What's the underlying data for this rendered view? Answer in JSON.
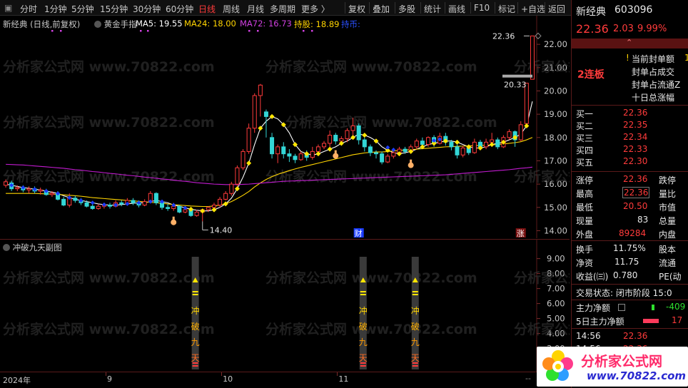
{
  "toolbar": {
    "left_items": [
      "分时",
      "1分钟",
      "5分钟",
      "15分钟",
      "30分钟",
      "60分钟",
      "日线",
      "周线",
      "月线",
      "多周期",
      "更多 〉"
    ],
    "active": "日线",
    "right_items": [
      "复权",
      "叠加",
      "多股",
      "统计",
      "画线",
      "F10",
      "标记",
      "+自选",
      "返回"
    ]
  },
  "chart_header": {
    "stock_label": "新经典 (日线,前复权)",
    "indicator": "黄金手指",
    "ma5": "MA5: 19.55",
    "ma24": "MA24: 18.00",
    "ma72": "MA72: 16.73",
    "hold": "持股: 18.89",
    "hold_suffix": "持币:"
  },
  "colors": {
    "red": "#ff3b3b",
    "green": "#2ee02e",
    "cyan": "#33d6d6",
    "ma5": "#ffffff",
    "ma24": "#ffd400",
    "ma72": "#c21bd0",
    "dots": "#ffe600",
    "blue_dots": "#1a3cff"
  },
  "chart_data": {
    "type": "candlestick",
    "title": "新经典 (日线,前复权)",
    "y_ticks": [
      "22.00",
      "21.00",
      "20.00",
      "19.00",
      "18.00",
      "17.00",
      "16.00",
      "15.00",
      "14.00"
    ],
    "ylim": [
      13.8,
      22.8
    ],
    "annotations": {
      "high_label": "22.36",
      "low_label": "14.40",
      "current_price_tag": "20.33",
      "cai_marker": "财",
      "zhang_marker": "涨"
    },
    "candles": [
      {
        "o": 15.95,
        "c": 16.1,
        "h": 16.2,
        "l": 15.85
      },
      {
        "o": 16.05,
        "c": 15.8,
        "h": 16.15,
        "l": 15.7
      },
      {
        "o": 15.8,
        "c": 15.85,
        "h": 15.95,
        "l": 15.7
      },
      {
        "o": 15.85,
        "c": 15.75,
        "h": 15.95,
        "l": 15.65
      },
      {
        "o": 15.75,
        "c": 15.8,
        "h": 15.9,
        "l": 15.6
      },
      {
        "o": 15.8,
        "c": 15.7,
        "h": 15.9,
        "l": 15.6
      },
      {
        "o": 15.7,
        "c": 15.75,
        "h": 15.85,
        "l": 15.55
      },
      {
        "o": 15.7,
        "c": 15.55,
        "h": 15.8,
        "l": 15.5
      },
      {
        "o": 15.55,
        "c": 15.6,
        "h": 15.7,
        "l": 15.45
      },
      {
        "o": 15.6,
        "c": 15.35,
        "h": 15.7,
        "l": 15.3
      },
      {
        "o": 15.35,
        "c": 15.1,
        "h": 15.45,
        "l": 15.05
      },
      {
        "o": 15.1,
        "c": 15.4,
        "h": 15.6,
        "l": 15.0
      },
      {
        "o": 15.4,
        "c": 15.3,
        "h": 15.5,
        "l": 15.2
      },
      {
        "o": 15.3,
        "c": 15.2,
        "h": 15.4,
        "l": 15.1
      },
      {
        "o": 15.2,
        "c": 15.05,
        "h": 15.3,
        "l": 15.0
      },
      {
        "o": 15.05,
        "c": 14.95,
        "h": 15.2,
        "l": 14.9
      },
      {
        "o": 14.95,
        "c": 15.05,
        "h": 15.15,
        "l": 14.9
      },
      {
        "o": 15.05,
        "c": 15.1,
        "h": 15.2,
        "l": 14.95
      },
      {
        "o": 15.1,
        "c": 15.05,
        "h": 15.2,
        "l": 14.95
      },
      {
        "o": 15.05,
        "c": 15.2,
        "h": 15.3,
        "l": 15.0
      },
      {
        "o": 15.2,
        "c": 15.15,
        "h": 15.3,
        "l": 15.05
      },
      {
        "o": 15.15,
        "c": 15.3,
        "h": 15.4,
        "l": 15.1
      },
      {
        "o": 15.3,
        "c": 15.2,
        "h": 15.4,
        "l": 15.1
      },
      {
        "o": 15.2,
        "c": 15.1,
        "h": 15.3,
        "l": 15.0
      },
      {
        "o": 15.1,
        "c": 15.25,
        "h": 15.35,
        "l": 15.05
      },
      {
        "o": 15.25,
        "c": 15.6,
        "h": 15.7,
        "l": 15.2
      },
      {
        "o": 15.6,
        "c": 15.2,
        "h": 15.65,
        "l": 15.1
      },
      {
        "o": 15.2,
        "c": 15.0,
        "h": 15.3,
        "l": 14.9
      },
      {
        "o": 15.0,
        "c": 14.95,
        "h": 15.15,
        "l": 14.85
      },
      {
        "o": 14.95,
        "c": 15.05,
        "h": 15.2,
        "l": 14.85
      },
      {
        "o": 15.05,
        "c": 14.8,
        "h": 15.1,
        "l": 14.75
      },
      {
        "o": 14.8,
        "c": 14.9,
        "h": 15.0,
        "l": 14.75
      },
      {
        "o": 14.9,
        "c": 14.65,
        "h": 14.95,
        "l": 14.6
      },
      {
        "o": 14.65,
        "c": 14.8,
        "h": 14.9,
        "l": 14.6
      },
      {
        "o": 14.8,
        "c": 14.9,
        "h": 14.95,
        "l": 14.4
      },
      {
        "o": 14.9,
        "c": 15.0,
        "h": 15.05,
        "l": 14.8
      },
      {
        "o": 15.0,
        "c": 15.1,
        "h": 15.2,
        "l": 14.9
      },
      {
        "o": 15.1,
        "c": 15.35,
        "h": 15.45,
        "l": 15.0
      },
      {
        "o": 15.35,
        "c": 15.6,
        "h": 15.7,
        "l": 15.3
      },
      {
        "o": 15.6,
        "c": 16.0,
        "h": 16.1,
        "l": 15.5
      },
      {
        "o": 16.0,
        "c": 16.7,
        "h": 16.8,
        "l": 15.9
      },
      {
        "o": 16.7,
        "c": 17.4,
        "h": 17.5,
        "l": 16.6
      },
      {
        "o": 17.4,
        "c": 18.4,
        "h": 18.6,
        "l": 17.3
      },
      {
        "o": 18.4,
        "c": 19.8,
        "h": 19.9,
        "l": 18.2
      },
      {
        "o": 19.8,
        "c": 20.25,
        "h": 20.3,
        "l": 18.9
      },
      {
        "o": 19.1,
        "c": 18.9,
        "h": 19.2,
        "l": 18.0
      },
      {
        "o": 18.0,
        "c": 17.3,
        "h": 18.2,
        "l": 17.1
      },
      {
        "o": 17.3,
        "c": 17.6,
        "h": 17.7,
        "l": 16.9
      },
      {
        "o": 17.6,
        "c": 17.3,
        "h": 17.8,
        "l": 17.1
      },
      {
        "o": 17.3,
        "c": 17.2,
        "h": 17.5,
        "l": 16.95
      },
      {
        "o": 17.2,
        "c": 17.05,
        "h": 17.3,
        "l": 16.9
      },
      {
        "o": 17.05,
        "c": 17.3,
        "h": 17.4,
        "l": 17.0
      },
      {
        "o": 17.3,
        "c": 17.15,
        "h": 17.45,
        "l": 17.0
      },
      {
        "o": 17.15,
        "c": 17.4,
        "h": 17.6,
        "l": 17.05
      },
      {
        "o": 17.4,
        "c": 17.6,
        "h": 17.7,
        "l": 17.3
      },
      {
        "o": 17.6,
        "c": 17.75,
        "h": 17.85,
        "l": 17.5
      },
      {
        "o": 17.75,
        "c": 18.1,
        "h": 18.3,
        "l": 17.6
      },
      {
        "o": 18.1,
        "c": 17.85,
        "h": 18.2,
        "l": 17.7
      },
      {
        "o": 17.85,
        "c": 17.95,
        "h": 18.05,
        "l": 17.7
      },
      {
        "o": 17.95,
        "c": 18.3,
        "h": 18.4,
        "l": 17.8
      },
      {
        "o": 18.3,
        "c": 18.5,
        "h": 18.85,
        "l": 18.0
      },
      {
        "o": 18.5,
        "c": 17.9,
        "h": 18.6,
        "l": 17.7
      },
      {
        "o": 17.9,
        "c": 17.6,
        "h": 18.0,
        "l": 17.4
      },
      {
        "o": 17.6,
        "c": 17.35,
        "h": 17.7,
        "l": 17.2
      },
      {
        "o": 17.35,
        "c": 17.3,
        "h": 17.45,
        "l": 17.1
      },
      {
        "o": 17.3,
        "c": 16.95,
        "h": 17.4,
        "l": 16.85
      },
      {
        "o": 16.95,
        "c": 17.2,
        "h": 17.3,
        "l": 16.9
      },
      {
        "o": 17.2,
        "c": 17.35,
        "h": 17.45,
        "l": 17.1
      },
      {
        "o": 17.35,
        "c": 17.5,
        "h": 17.6,
        "l": 17.25
      },
      {
        "o": 17.5,
        "c": 17.4,
        "h": 17.6,
        "l": 17.3
      },
      {
        "o": 17.4,
        "c": 17.6,
        "h": 17.7,
        "l": 17.3
      },
      {
        "o": 17.6,
        "c": 17.85,
        "h": 17.95,
        "l": 17.5
      },
      {
        "o": 17.85,
        "c": 17.7,
        "h": 18.0,
        "l": 17.6
      },
      {
        "o": 17.7,
        "c": 18.0,
        "h": 18.05,
        "l": 17.6
      },
      {
        "o": 18.0,
        "c": 17.75,
        "h": 18.1,
        "l": 17.6
      },
      {
        "o": 17.75,
        "c": 18.05,
        "h": 18.2,
        "l": 17.7
      },
      {
        "o": 18.05,
        "c": 17.8,
        "h": 18.2,
        "l": 17.65
      },
      {
        "o": 17.8,
        "c": 17.6,
        "h": 17.9,
        "l": 17.45
      },
      {
        "o": 17.6,
        "c": 17.25,
        "h": 17.7,
        "l": 17.1
      },
      {
        "o": 17.25,
        "c": 17.55,
        "h": 17.65,
        "l": 17.15
      },
      {
        "o": 17.55,
        "c": 17.35,
        "h": 17.7,
        "l": 17.25
      },
      {
        "o": 17.35,
        "c": 17.8,
        "h": 17.95,
        "l": 17.3
      },
      {
        "o": 17.8,
        "c": 17.6,
        "h": 17.9,
        "l": 17.5
      },
      {
        "o": 17.6,
        "c": 17.8,
        "h": 17.95,
        "l": 17.5
      },
      {
        "o": 17.8,
        "c": 17.9,
        "h": 18.2,
        "l": 17.7
      },
      {
        "o": 17.9,
        "c": 17.6,
        "h": 18.0,
        "l": 17.5
      },
      {
        "o": 17.6,
        "c": 18.0,
        "h": 18.1,
        "l": 17.55
      },
      {
        "o": 18.0,
        "c": 18.25,
        "h": 18.35,
        "l": 17.9
      },
      {
        "o": 18.25,
        "c": 17.9,
        "h": 18.3,
        "l": 17.6
      },
      {
        "o": 17.9,
        "c": 18.55,
        "h": 18.7,
        "l": 17.85
      },
      {
        "o": 18.6,
        "c": 20.33,
        "h": 20.33,
        "l": 18.5
      },
      {
        "o": 20.5,
        "c": 22.36,
        "h": 22.36,
        "l": 20.5
      }
    ],
    "series": [
      {
        "name": "MA5",
        "values": [
          16.0,
          15.95,
          15.9,
          15.85,
          15.82,
          15.78,
          15.75,
          15.7,
          15.65,
          15.6,
          15.5,
          15.42,
          15.35,
          15.3,
          15.25,
          15.2,
          15.15,
          15.12,
          15.1,
          15.1,
          15.12,
          15.15,
          15.18,
          15.2,
          15.2,
          15.25,
          15.3,
          15.25,
          15.2,
          15.1,
          15.05,
          14.98,
          14.92,
          14.88,
          14.85,
          14.85,
          14.9,
          15.0,
          15.15,
          15.4,
          15.8,
          16.3,
          16.9,
          17.7,
          18.4,
          18.7,
          18.9,
          18.8,
          18.55,
          18.2,
          17.7,
          17.4,
          17.3,
          17.25,
          17.3,
          17.4,
          17.5,
          17.6,
          17.75,
          17.85,
          18.0,
          18.15,
          18.1,
          18.0,
          17.85,
          17.6,
          17.45,
          17.35,
          17.3,
          17.35,
          17.4,
          17.5,
          17.6,
          17.7,
          17.75,
          17.8,
          17.85,
          17.85,
          17.8,
          17.7,
          17.6,
          17.55,
          17.55,
          17.6,
          17.7,
          17.75,
          17.8,
          17.9,
          18.0,
          18.15,
          18.5,
          19.55
        ]
      },
      {
        "name": "MA24",
        "values": [
          15.6,
          15.6,
          15.6,
          15.6,
          15.6,
          15.6,
          15.59,
          15.58,
          15.57,
          15.56,
          15.54,
          15.52,
          15.5,
          15.48,
          15.45,
          15.42,
          15.4,
          15.38,
          15.36,
          15.34,
          15.32,
          15.3,
          15.28,
          15.26,
          15.24,
          15.22,
          15.2,
          15.18,
          15.15,
          15.12,
          15.1,
          15.08,
          15.06,
          15.05,
          15.04,
          15.04,
          15.06,
          15.1,
          15.16,
          15.25,
          15.38,
          15.52,
          15.68,
          15.88,
          16.05,
          16.2,
          16.32,
          16.42,
          16.5,
          16.58,
          16.65,
          16.72,
          16.78,
          16.84,
          16.9,
          16.96,
          17.02,
          17.08,
          17.14,
          17.2,
          17.26,
          17.3,
          17.34,
          17.36,
          17.38,
          17.38,
          17.4,
          17.42,
          17.44,
          17.46,
          17.48,
          17.5,
          17.52,
          17.54,
          17.56,
          17.58,
          17.6,
          17.61,
          17.62,
          17.63,
          17.64,
          17.65,
          17.66,
          17.67,
          17.68,
          17.7,
          17.72,
          17.75,
          17.78,
          17.82,
          17.9,
          18.0
        ]
      },
      {
        "name": "MA72",
        "values": [
          16.85,
          16.84,
          16.83,
          16.82,
          16.8,
          16.78,
          16.76,
          16.74,
          16.72,
          16.7,
          16.68,
          16.65,
          16.62,
          16.6,
          16.57,
          16.54,
          16.52,
          16.49,
          16.46,
          16.44,
          16.41,
          16.38,
          16.36,
          16.33,
          16.3,
          16.28,
          16.25,
          16.22,
          16.2,
          16.17,
          16.14,
          16.12,
          16.09,
          16.06,
          16.04,
          16.02,
          16.0,
          15.99,
          15.98,
          15.98,
          15.98,
          15.99,
          16.0,
          16.02,
          16.04,
          16.06,
          16.08,
          16.1,
          16.12,
          16.13,
          16.14,
          16.15,
          16.16,
          16.17,
          16.18,
          16.19,
          16.2,
          16.21,
          16.22,
          16.23,
          16.24,
          16.25,
          16.26,
          16.27,
          16.28,
          16.29,
          16.3,
          16.31,
          16.32,
          16.33,
          16.34,
          16.35,
          16.36,
          16.37,
          16.38,
          16.39,
          16.4,
          16.42,
          16.44,
          16.46,
          16.48,
          16.5,
          16.52,
          16.54,
          16.56,
          16.58,
          16.6,
          16.62,
          16.65,
          16.68,
          16.7,
          16.73
        ]
      }
    ],
    "golden_finger_start": 32,
    "sub_chart": {
      "title": "冲破九天副图",
      "y_ticks": [
        "9.00",
        "8.00",
        "7.00",
        "6.00",
        "5.00",
        "4.00",
        "3.00",
        "2.00"
      ],
      "ylim": [
        1.6,
        9.6
      ],
      "signal_positions": [
        33,
        62,
        71
      ],
      "signal_text": [
        "冲",
        "破",
        "九",
        "天"
      ]
    },
    "x_labels": [
      {
        "label": "2024年",
        "i": 0
      },
      {
        "label": "9",
        "i": 18
      },
      {
        "label": "10",
        "i": 38
      },
      {
        "label": "11",
        "i": 58
      }
    ]
  },
  "right_panel": {
    "stock_name": "新经典",
    "stock_code": "603096",
    "price": "22.36",
    "change": "2.03",
    "change_pct": "9.99%",
    "board_tag": "2连板",
    "seal_items": [
      "当前封单额",
      "封单占成交",
      "封单占流通Z",
      "十日总涨幅"
    ],
    "seal_value": "1",
    "buy_levels": [
      {
        "label": "买一",
        "price": "22.36"
      },
      {
        "label": "买二",
        "price": "22.35"
      },
      {
        "label": "买三",
        "price": "22.34"
      },
      {
        "label": "买四",
        "price": "22.33"
      },
      {
        "label": "买五",
        "price": "22.30"
      }
    ],
    "quote": [
      {
        "l1": "涨停",
        "v1": "22.36",
        "l2": "跌停"
      },
      {
        "l1": "最高",
        "v1": "22.36",
        "l2": "量比"
      },
      {
        "l1": "最低",
        "v1": "20.50",
        "l2": "市值"
      },
      {
        "l1": "现量",
        "v1": "83",
        "l2": "总量"
      },
      {
        "l1": "外盘",
        "v1": "89284",
        "l2": "内盘"
      }
    ],
    "stats": [
      {
        "l1": "换手",
        "v1": "11.75%",
        "l2": "股本"
      },
      {
        "l1": "净资",
        "v1": "11.75",
        "l2": "流通"
      },
      {
        "l1": "收益(㈢)",
        "v1": "0.780",
        "l2": "PE(动"
      }
    ],
    "trade_status": "交易状态: 闭市阶段 15:0",
    "main_net": {
      "label": "主力净额",
      "value": "-409"
    },
    "main_net_5d": {
      "label": "5日主力净额",
      "value": "17"
    },
    "ticks": [
      {
        "time": "14:56",
        "price": "22.36"
      },
      {
        "time": "14:56",
        "price": "22.36"
      }
    ]
  },
  "watermark": {
    "text": "分析家公式网 www.70822.com",
    "logo_title": "分析家公式网",
    "logo_url": "www.70822.com"
  },
  "misc": {
    "scroll_end": "--"
  }
}
